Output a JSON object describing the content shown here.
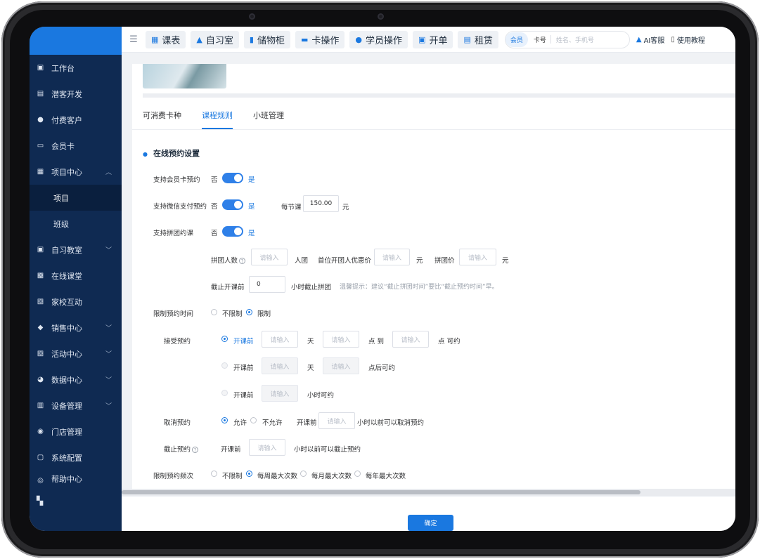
{
  "sidebar": {
    "items": [
      {
        "label": "工作台",
        "icon": "dashboard-icon",
        "glyph": "▣"
      },
      {
        "label": "潜客开发",
        "icon": "id-card-icon",
        "glyph": "▤"
      },
      {
        "label": "付费客户",
        "icon": "users-icon",
        "glyph": "●"
      },
      {
        "label": "会员卡",
        "icon": "card-icon",
        "glyph": "▭"
      },
      {
        "label": "项目中心",
        "icon": "project-icon",
        "glyph": "▦",
        "chevron": "︿"
      },
      {
        "label": "自习教室",
        "icon": "classroom-icon",
        "glyph": "▣",
        "chevron": "﹀"
      },
      {
        "label": "在线课堂",
        "icon": "online-class-icon",
        "glyph": "▩"
      },
      {
        "label": "家校互动",
        "icon": "interaction-icon",
        "glyph": "▧"
      },
      {
        "label": "销售中心",
        "icon": "sales-tag-icon",
        "glyph": "◆",
        "chevron": "﹀"
      },
      {
        "label": "活动中心",
        "icon": "activity-icon",
        "glyph": "▨",
        "chevron": "﹀"
      },
      {
        "label": "数据中心",
        "icon": "pie-chart-icon",
        "glyph": "◕",
        "chevron": "﹀"
      },
      {
        "label": "设备管理",
        "icon": "device-icon",
        "glyph": "▥",
        "chevron": "﹀"
      },
      {
        "label": "门店管理",
        "icon": "store-icon",
        "glyph": "◉"
      },
      {
        "label": "系统配置",
        "icon": "monitor-icon",
        "glyph": "▢"
      },
      {
        "label": "帮助中心",
        "icon": "help-icon",
        "glyph": "◎"
      }
    ],
    "subitems": [
      "项目",
      "班级"
    ],
    "apps_glyph": "▚"
  },
  "topbar": {
    "menu_glyph": "☰",
    "buttons": [
      {
        "label": "课表",
        "icon": "calendar-icon",
        "glyph": "▦"
      },
      {
        "label": "自习室",
        "icon": "study-room-icon",
        "glyph": "▲"
      },
      {
        "label": "储物柜",
        "icon": "locker-icon",
        "glyph": "▮"
      },
      {
        "label": "卡操作",
        "icon": "card-op-icon",
        "glyph": "▬"
      },
      {
        "label": "学员操作",
        "icon": "student-icon",
        "glyph": "●"
      },
      {
        "label": "开单",
        "icon": "order-icon",
        "glyph": "▣"
      },
      {
        "label": "租赁",
        "icon": "lease-icon",
        "glyph": "▤"
      }
    ],
    "search": {
      "tag": "会员",
      "select": "卡号",
      "placeholder": "姓名、手机号"
    },
    "ai_service": "AI客服",
    "tutorial": "使用教程"
  },
  "tabs": [
    "可消费卡种",
    "课程规则",
    "小班管理"
  ],
  "active_tab": "课程规则",
  "section_title": "在线预约设置",
  "form": {
    "member_booking": {
      "label": "支持会员卡预约",
      "off": "否",
      "on": "是",
      "enabled": true
    },
    "wechat_booking": {
      "label": "支持微信支付预约",
      "off": "否",
      "on": "是",
      "enabled": true,
      "price_label": "每节课",
      "price_value": "150.00",
      "unit": "元"
    },
    "group_booking": {
      "label": "支持拼团约课",
      "off": "否",
      "on": "是",
      "enabled": true
    },
    "group_size": {
      "label": "拼团人数",
      "placeholder": "请输入",
      "unit": "人团"
    },
    "first_discount": {
      "label": "首位开团人优惠价",
      "placeholder": "请输入",
      "unit": "元"
    },
    "group_price": {
      "label": "拼团价",
      "placeholder": "请输入",
      "unit": "元"
    },
    "deadline": {
      "label": "截止开课前",
      "value": "0",
      "unit": "小时截止拼团",
      "tip": "温馨提示：建议“截止拼团时间”要比“截止预约时间”早。"
    },
    "limit_time": {
      "label": "限制预约时间",
      "options": [
        "不限制",
        "限制"
      ],
      "selected": "限制"
    },
    "accept": {
      "label": "接受预约",
      "row1": {
        "option": "开课前",
        "placeholder": "请输入",
        "u1": "天",
        "u2": "点 到",
        "u3": "点 可约",
        "selected": true
      },
      "row2": {
        "option": "开课前",
        "placeholder": "请输入",
        "u1": "天",
        "u2": "点后可约",
        "selected": false
      },
      "row3": {
        "option": "开课前",
        "placeholder": "请输入",
        "u1": "小时可约",
        "selected": false
      }
    },
    "cancel": {
      "label": "取消预约",
      "options": [
        "允许",
        "不允许"
      ],
      "selected": "允许",
      "prefix": "开课前",
      "placeholder": "请输入",
      "suffix": "小时以前可以取消预约"
    },
    "cutoff": {
      "label": "截止预约",
      "prefix": "开课前",
      "placeholder": "请输入",
      "suffix": "小时以前可以截止预约"
    },
    "frequency": {
      "label": "限制预约频次",
      "options": [
        "不限制",
        "每周最大次数",
        "每月最大次数",
        "每年最大次数"
      ],
      "selected": "每周最大次数"
    }
  },
  "footer": {
    "confirm": "确定"
  },
  "colors": {
    "accent": "#1a78e0",
    "sidebar": "#0f2a52"
  }
}
